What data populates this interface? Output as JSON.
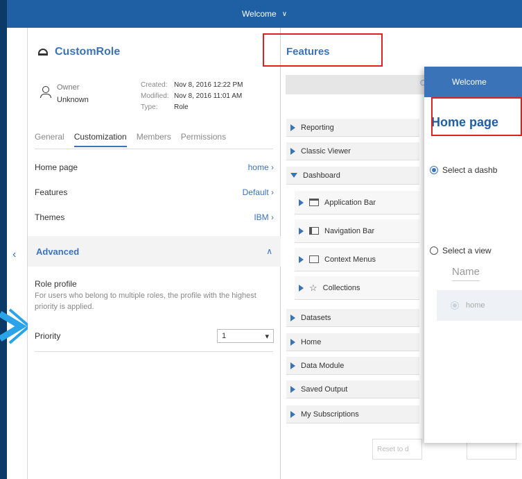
{
  "topbar": {
    "title": "Welcome"
  },
  "role": {
    "name": "CustomRole",
    "owner_label": "Owner",
    "owner_value": "Unknown",
    "created_label": "Created:",
    "created_value": "Nov 8, 2016 12:22 PM",
    "modified_label": "Modified:",
    "modified_value": "Nov 8, 2016 11:01 AM",
    "type_label": "Type:",
    "type_value": "Role"
  },
  "tabs": [
    "General",
    "Customization",
    "Members",
    "Permissions"
  ],
  "settings": [
    {
      "label": "Home page",
      "value": "home"
    },
    {
      "label": "Features",
      "value": "Default"
    },
    {
      "label": "Themes",
      "value": "IBM"
    }
  ],
  "advanced": {
    "label": "Advanced",
    "profile_title": "Role profile",
    "profile_hint": "For users who belong to multiple roles, the profile with the highest priority is applied.",
    "priority_label": "Priority",
    "priority_value": "1"
  },
  "features": {
    "title": "Features",
    "items": [
      "Reporting",
      "Classic Viewer",
      "Dashboard",
      "Application Bar",
      "Navigation Bar",
      "Context Menus",
      "Collections",
      "Datasets",
      "Home",
      "Data Module",
      "Saved Output",
      "My Subscriptions"
    ],
    "reset_label": "Reset to d"
  },
  "homepage_dialog": {
    "header": "Welcome",
    "title": "Home page",
    "option_dashboard": "Select a dashb",
    "option_view": "Select a view",
    "name_header": "Name",
    "view_item": "home"
  },
  "colors": {
    "accent": "#3b73b9",
    "highlight": "#e0201e",
    "background": "#0b3a66"
  }
}
